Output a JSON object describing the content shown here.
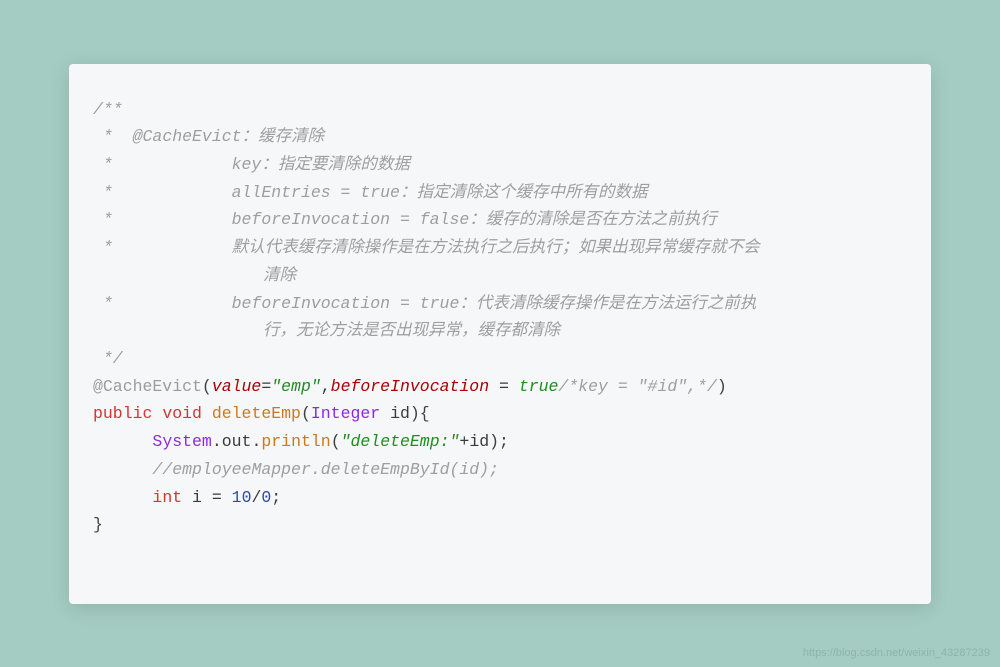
{
  "code": {
    "c01": "/**",
    "c02": " *  @CacheEvict：缓存清除",
    "c03": " *            key：指定要清除的数据",
    "c04": " *            allEntries = true：指定清除这个缓存中所有的数据",
    "c05": " *            beforeInvocation = false：缓存的清除是否在方法之前执行",
    "c06a": " *            默认代表缓存清除操作是在方法执行之后执行；如果出现异常缓存就不会",
    "c06b": "清除",
    "c07a": " *            beforeInvocation = true：代表清除缓存操作是在方法运行之前执",
    "c07b": "行，无论方法是否出现异常，缓存都清除",
    "c08": " */",
    "ann": {
      "at": "@CacheEvict",
      "lp": "(",
      "k1": "value",
      "eq1": "=",
      "v1": "\"emp\"",
      "comma": ",",
      "k2": "beforeInvocation ",
      "eq2": "= ",
      "v2": "true",
      "tail": "/*key = \"#id\",*/",
      "rp": ")"
    },
    "sig": {
      "kw1": "public",
      "sp1": " ",
      "kw2": "void",
      "sp2": " ",
      "meth": "deleteEmp",
      "lp": "(",
      "type": "Integer",
      "sp3": " ",
      "param": "id",
      "rp": "){",
      "close": "}"
    },
    "body": {
      "indent": "      ",
      "sys": "System",
      "dot1": ".",
      "out": "out",
      "dot2": ".",
      "pr": "println",
      "lp": "(",
      "str": "\"deleteEmp:\"",
      "plus": "+",
      "id": "id",
      "rp": ");",
      "cmt": "      //employeeMapper.deleteEmpById(id);",
      "kw": "int",
      "sp": " ",
      "var": "i ",
      "eq": "= ",
      "n1": "10",
      "sl": "/",
      "n2": "0",
      "semi": ";"
    }
  },
  "watermark": "https://blog.csdn.net/weixin_43287239"
}
